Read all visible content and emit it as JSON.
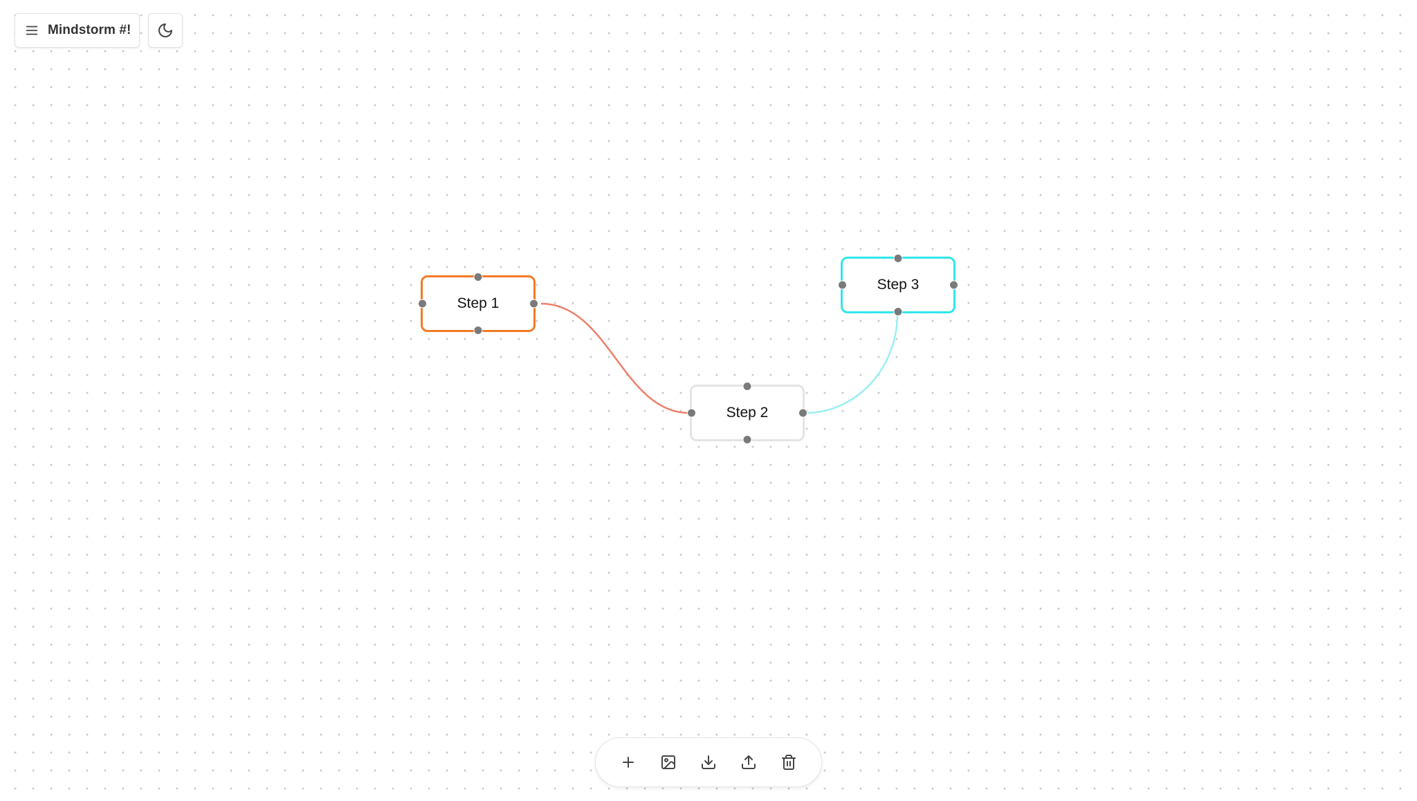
{
  "app": {
    "menu_label": "Mindstorm #!",
    "theme_toggle_icon": "moon-icon",
    "menu_icon": "hamburger-menu-icon"
  },
  "nodes": [
    {
      "id": "1",
      "label": "Step 1",
      "border_color": "#f37a25"
    },
    {
      "id": "2",
      "label": "Step 2",
      "border_color": "#e4e4e4"
    },
    {
      "id": "3",
      "label": "Step 3",
      "border_color": "#2fe6ea"
    }
  ],
  "edges": [
    {
      "from": "1",
      "to": "2",
      "color": "#ee7f6a"
    },
    {
      "from": "2",
      "to": "3",
      "color": "#9aeff2"
    }
  ],
  "toolbar": {
    "buttons": [
      {
        "icon": "plus-icon"
      },
      {
        "icon": "image-icon"
      },
      {
        "icon": "download-icon"
      },
      {
        "icon": "upload-icon"
      },
      {
        "icon": "trash-icon"
      }
    ]
  },
  "colors": {
    "handle": "#7a7a7a",
    "icon": "#444444",
    "canvas_dot": "#c9c9c9"
  }
}
